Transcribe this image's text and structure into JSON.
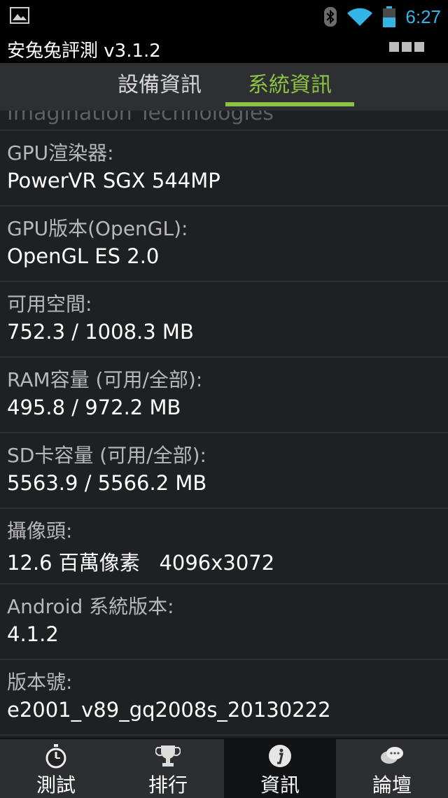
{
  "status": {
    "time": "6:27",
    "icons": [
      "image-notification-icon",
      "bluetooth-icon",
      "wifi-icon",
      "battery-icon"
    ]
  },
  "appbar": {
    "title": "安兔兔評測 v3.1.2"
  },
  "tabs": [
    {
      "label": "設備資訊",
      "active": false
    },
    {
      "label": "系統資訊",
      "active": true
    }
  ],
  "list": {
    "cut_off_text": "Imagination Technologies",
    "rows": [
      {
        "label": "GPU渲染器:",
        "value": "PowerVR SGX 544MP"
      },
      {
        "label": "GPU版本(OpenGL):",
        "value": "OpenGL ES 2.0"
      },
      {
        "label": "可用空間:",
        "value": "752.3 / 1008.3 MB"
      },
      {
        "label": "RAM容量 (可用/全部):",
        "value": "495.8 / 972.2 MB"
      },
      {
        "label": "SD卡容量 (可用/全部):",
        "value": "5563.9 / 5566.2 MB"
      },
      {
        "label": "攝像頭:",
        "value": "12.6 百萬像素   4096x3072"
      },
      {
        "label": "Android 系統版本:",
        "value": "4.1.2"
      },
      {
        "label": "版本號:",
        "value": "e2001_v89_gq2008s_20130222"
      }
    ]
  },
  "bottom_nav": [
    {
      "label": "測試",
      "icon": "stopwatch-icon",
      "active": false
    },
    {
      "label": "排行",
      "icon": "trophy-icon",
      "active": false
    },
    {
      "label": "資訊",
      "icon": "info-icon",
      "active": true
    },
    {
      "label": "論壇",
      "icon": "chat-bubbles-icon",
      "active": false
    }
  ],
  "colors": {
    "accent_green": "#8bc442",
    "status_blue": "#33b5e5"
  }
}
